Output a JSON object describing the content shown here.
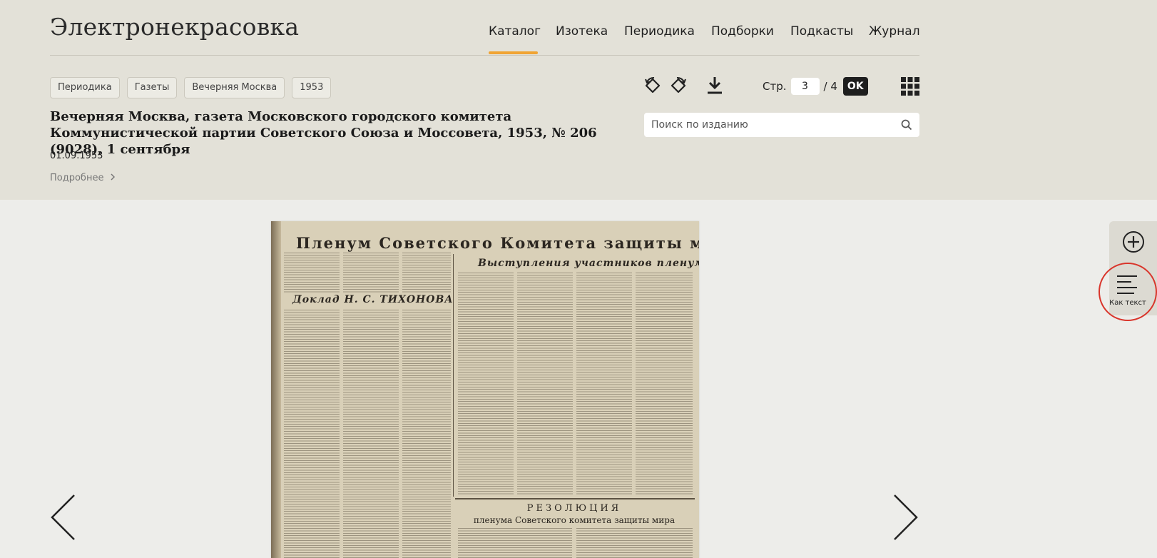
{
  "site": {
    "logo": "Электронекрасовка"
  },
  "nav": {
    "items": [
      "Каталог",
      "Изотека",
      "Периодика",
      "Подборки",
      "Подкасты",
      "Журнал"
    ],
    "active": "Каталог"
  },
  "breadcrumbs": [
    "Периодика",
    "Газеты",
    "Вечерняя Москва",
    "1953"
  ],
  "document": {
    "title": "Вечерняя Москва, газета Московского городского комитета Коммунистической партии Советского Союза и Моссовета, 1953, № 206 (9028), 1 сентября",
    "date": "01.09.1953",
    "more_label": "Подробнее"
  },
  "toolbar": {
    "rotate_left_icon": "rotate-left-icon",
    "rotate_right_icon": "rotate-right-icon",
    "download_icon": "download-icon",
    "grid_icon": "grid-icon"
  },
  "pager": {
    "label": "Стр.",
    "current": "3",
    "total": "/ 4",
    "ok_label": "OK"
  },
  "search": {
    "placeholder": "Поиск по изданию"
  },
  "viewer": {
    "newspaper": {
      "headline": "Пленум Советского Комитета защиты мира",
      "subheadline": "Выступления участников пленума",
      "report_heading": "Доклад Н. С. ТИХОНОВА",
      "resolution_heading": "РЕЗОЛЮЦИЯ",
      "resolution_sub": "пленума Советского комитета защиты мира"
    },
    "side_panel": {
      "zoom_icon": "zoom-in-icon",
      "as_text_label": "Как текст"
    }
  },
  "colors": {
    "accent": "#f0a434",
    "header_bg": "#e3e1d8",
    "page_bg": "#ededea",
    "highlight_circle": "#d9352b"
  }
}
